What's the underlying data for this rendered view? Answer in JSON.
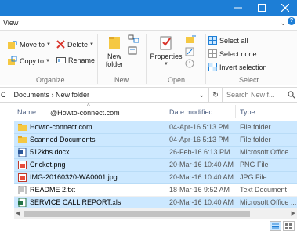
{
  "menu": {
    "view_label": "View"
  },
  "ribbon": {
    "organize": {
      "label": "Organize",
      "move_to": "Move to",
      "delete": "Delete",
      "copy_to": "Copy to",
      "rename": "Rename"
    },
    "new": {
      "label": "New",
      "new_folder": "New\nfolder"
    },
    "open": {
      "label": "Open",
      "properties": "Properties"
    },
    "select": {
      "label": "Select",
      "select_all": "Select all",
      "select_none": "Select none",
      "invert": "Invert selection"
    }
  },
  "address": {
    "path": "Documents  ›  New folder",
    "left_fragment": "C",
    "search_placeholder": "Search New f..."
  },
  "columns": {
    "name": "Name",
    "date": "Date modified",
    "type": "Type"
  },
  "watermark": "@Howto-connect.com",
  "files": [
    {
      "name": "Howto-connect.com",
      "date": "04-Apr-16 5:13 PM",
      "type": "File folder",
      "icon": "folder-icon"
    },
    {
      "name": "Scanned Documents",
      "date": "04-Apr-16 5:13 PM",
      "type": "File folder",
      "icon": "folder-icon"
    },
    {
      "name": "512kbs.docx",
      "date": "26-Feb-16 6:13 PM",
      "type": "Microsoft Office ...",
      "icon": "word-icon"
    },
    {
      "name": "Cricket.png",
      "date": "20-Mar-16 10:40 AM",
      "type": "PNG File",
      "icon": "image-icon"
    },
    {
      "name": "IMG-20160320-WA0001.jpg",
      "date": "20-Mar-16 10:40 AM",
      "type": "JPG File",
      "icon": "image-icon"
    },
    {
      "name": "README 2.txt",
      "date": "18-Mar-16 9:52 AM",
      "type": "Text Document",
      "icon": "text-file-icon"
    },
    {
      "name": "SERVICE  CALL REPORT.xls",
      "date": "20-Mar-16 10:40 AM",
      "type": "Microsoft Office ...",
      "icon": "excel-icon"
    }
  ],
  "colors": {
    "titlebar": "#1d7ed6",
    "selection": "#cce8ff"
  }
}
